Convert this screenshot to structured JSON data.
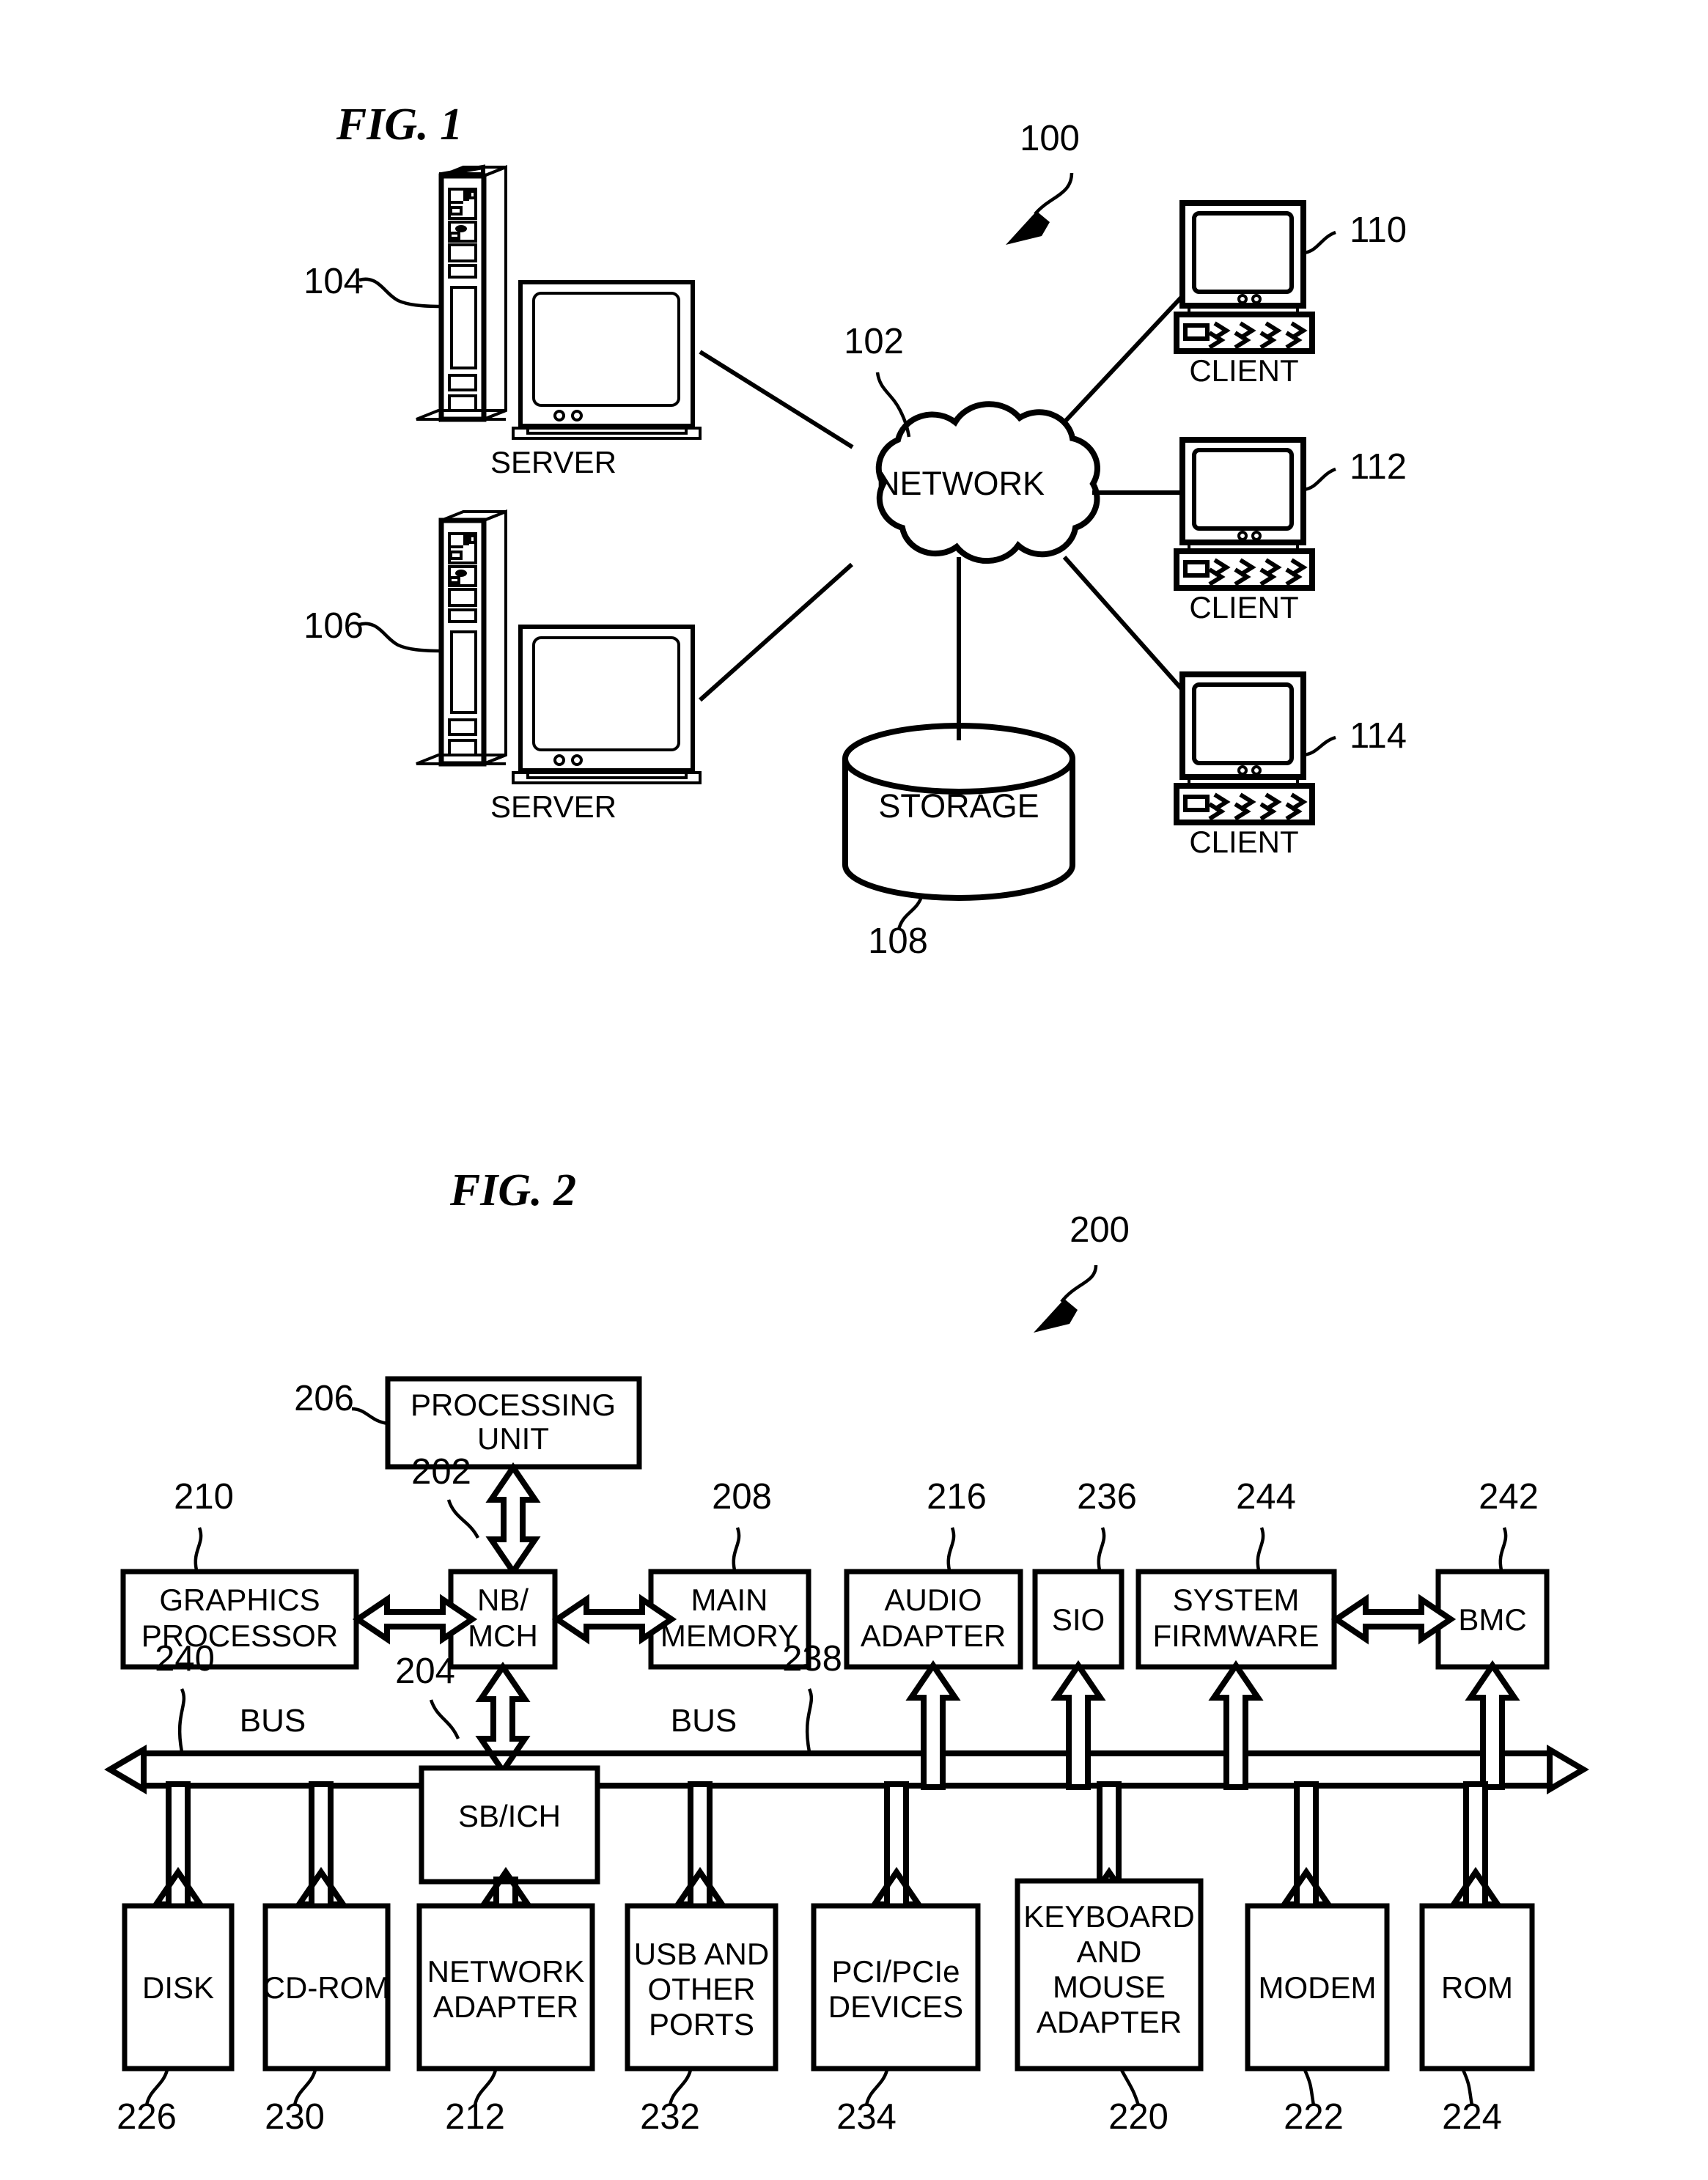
{
  "figure1": {
    "title": "FIG. 1",
    "system_ref": "100",
    "nodes": {
      "server_top": {
        "label": "SERVER",
        "ref": "104"
      },
      "server_bottom": {
        "label": "SERVER",
        "ref": "106"
      },
      "network": {
        "label": "NETWORK",
        "ref": "102"
      },
      "storage": {
        "label": "STORAGE",
        "ref": "108"
      },
      "client_1": {
        "label": "CLIENT",
        "ref": "110"
      },
      "client_2": {
        "label": "CLIENT",
        "ref": "112"
      },
      "client_3": {
        "label": "CLIENT",
        "ref": "114"
      }
    }
  },
  "figure2": {
    "title": "FIG. 2",
    "system_ref": "200",
    "processing_unit": {
      "label_line1": "PROCESSING",
      "label_line2": "UNIT",
      "ref": "206"
    },
    "nb_mch": {
      "label_line1": "NB/",
      "label_line2": "MCH",
      "ref": "202"
    },
    "sb_ich": {
      "label": "SB/ICH",
      "ref": "204"
    },
    "middle_row": [
      {
        "name": "graphics-processor",
        "label_line1": "GRAPHICS",
        "label_line2": "PROCESSOR",
        "ref": "210"
      },
      {
        "name": "main-memory",
        "label_line1": "MAIN",
        "label_line2": "MEMORY",
        "ref": "208"
      },
      {
        "name": "audio-adapter",
        "label_line1": "AUDIO",
        "label_line2": "ADAPTER",
        "ref": "216"
      },
      {
        "name": "sio",
        "label_line1": "SIO",
        "label_line2": "",
        "ref": "236"
      },
      {
        "name": "system-firmware",
        "label_line1": "SYSTEM",
        "label_line2": "FIRMWARE",
        "ref": "244"
      },
      {
        "name": "bmc",
        "label_line1": "BMC",
        "label_line2": "",
        "ref": "242"
      }
    ],
    "bus_left": {
      "label": "BUS",
      "ref": "240"
    },
    "bus_right": {
      "label": "BUS",
      "ref": "238"
    },
    "bottom_row": [
      {
        "name": "disk",
        "lines": [
          "DISK"
        ],
        "ref": "226"
      },
      {
        "name": "cd-rom",
        "lines": [
          "CD-ROM"
        ],
        "ref": "230"
      },
      {
        "name": "network-adapter",
        "lines": [
          "NETWORK",
          "ADAPTER"
        ],
        "ref": "212"
      },
      {
        "name": "usb-and-other-ports",
        "lines": [
          "USB AND",
          "OTHER",
          "PORTS"
        ],
        "ref": "232"
      },
      {
        "name": "pci-pcie-devices",
        "lines": [
          "PCI/PCIe",
          "DEVICES"
        ],
        "ref": "234"
      },
      {
        "name": "keyboard-and-mouse-adapter",
        "lines": [
          "KEYBOARD",
          "AND",
          "MOUSE",
          "ADAPTER"
        ],
        "ref": "220"
      },
      {
        "name": "modem",
        "lines": [
          "MODEM"
        ],
        "ref": "222"
      },
      {
        "name": "rom",
        "lines": [
          "ROM"
        ],
        "ref": "224"
      }
    ]
  }
}
